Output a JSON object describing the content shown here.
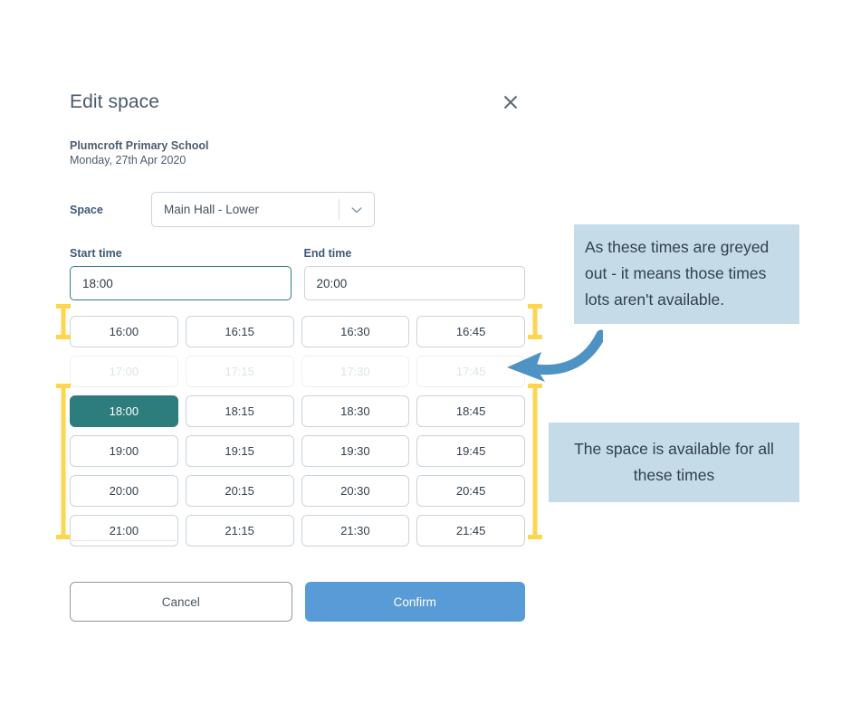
{
  "dialog": {
    "title": "Edit space",
    "close_icon": "close-icon",
    "org_name": "Plumcroft Primary School",
    "date": "Monday, 27th Apr 2020",
    "space": {
      "label": "Space",
      "selected": "Main Hall - Lower",
      "chevron_icon": "chevron-down-icon"
    },
    "start_time": {
      "label": "Start time",
      "value": "18:00"
    },
    "end_time": {
      "label": "End time",
      "value": "20:00"
    },
    "slots": [
      {
        "time": "16:00",
        "state": "available"
      },
      {
        "time": "16:15",
        "state": "available"
      },
      {
        "time": "16:30",
        "state": "available"
      },
      {
        "time": "16:45",
        "state": "available"
      },
      {
        "time": "17:00",
        "state": "disabled"
      },
      {
        "time": "17:15",
        "state": "disabled"
      },
      {
        "time": "17:30",
        "state": "disabled"
      },
      {
        "time": "17:45",
        "state": "disabled"
      },
      {
        "time": "18:00",
        "state": "selected"
      },
      {
        "time": "18:15",
        "state": "available"
      },
      {
        "time": "18:30",
        "state": "available"
      },
      {
        "time": "18:45",
        "state": "available"
      },
      {
        "time": "19:00",
        "state": "available"
      },
      {
        "time": "19:15",
        "state": "available"
      },
      {
        "time": "19:30",
        "state": "available"
      },
      {
        "time": "19:45",
        "state": "available"
      },
      {
        "time": "20:00",
        "state": "available"
      },
      {
        "time": "20:15",
        "state": "available"
      },
      {
        "time": "20:30",
        "state": "available"
      },
      {
        "time": "20:45",
        "state": "available"
      },
      {
        "time": "21:00",
        "state": "available"
      },
      {
        "time": "21:15",
        "state": "available"
      },
      {
        "time": "21:30",
        "state": "available"
      },
      {
        "time": "21:45",
        "state": "available"
      }
    ],
    "cancel_label": "Cancel",
    "confirm_label": "Confirm"
  },
  "annotations": {
    "greyed_note": "As these times are greyed out - it means those times lots aren't available.",
    "available_note": "The space is available for all these times",
    "arrow_icon": "curved-arrow-icon"
  },
  "colors": {
    "selected_slot": "#2e7d7d",
    "confirm_button": "#589bd6",
    "callout_background": "#c5dce8",
    "bracket": "#fcd551",
    "arrow": "#4f92c4",
    "focused_input_border": "#2f7f7f"
  }
}
